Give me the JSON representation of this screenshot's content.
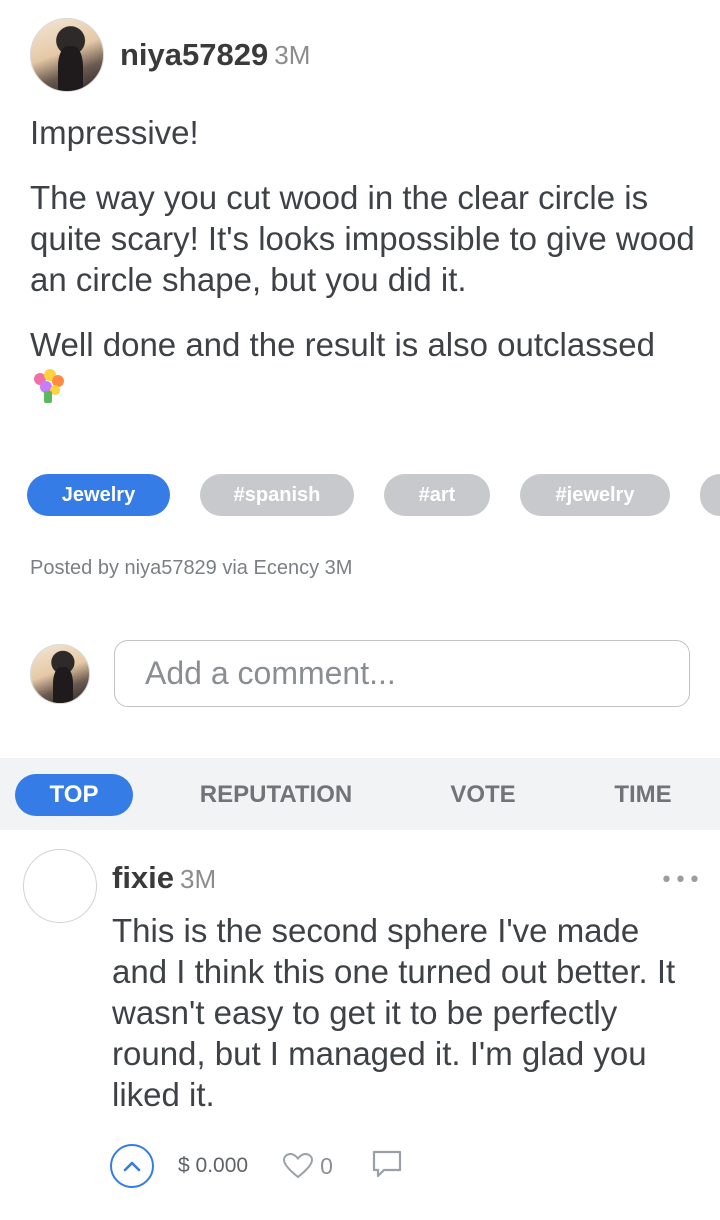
{
  "post": {
    "author": "niya57829",
    "time": "3M",
    "paragraphs": [
      "Impressive!",
      "The way you cut wood in the clear circle is quite scary! It's looks impossible to give wood an circle shape, but you did it.",
      "Well done and the result is also outclassed"
    ],
    "emoji": "bouquet",
    "tags": [
      "Jewelry",
      "#spanish",
      "#art",
      "#jewelry",
      ""
    ],
    "posted_by": "Posted by niya57829 via Ecency 3M"
  },
  "comment_input": {
    "placeholder": "Add a comment..."
  },
  "sort": {
    "options": [
      "TOP",
      "REPUTATION",
      "VOTE",
      "TIME"
    ],
    "selected": "TOP"
  },
  "comment": {
    "author": "fixie",
    "time": "3M",
    "more": "•••",
    "body": "This is the second sphere I've made and I think this one turned out better. It wasn't easy to get it to be perfectly round, but I managed it. I'm glad you liked it.",
    "payout": "$ 0.000",
    "likes": "0",
    "icons": [
      "upvote-icon",
      "heart-icon",
      "reply-icon"
    ]
  },
  "colors": {
    "accent": "#357ce6",
    "tag_inactive": "#c7c9cc",
    "sort_bar_bg": "#f2f3f5",
    "text": "#3e4146"
  }
}
